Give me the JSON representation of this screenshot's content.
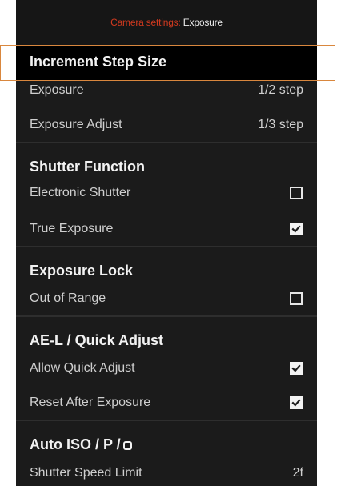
{
  "header": {
    "prefix": "Camera settings:",
    "current": "Exposure"
  },
  "sections": {
    "increment": {
      "title": "Increment Step Size",
      "rows": [
        {
          "label": "Exposure",
          "value": "1/2 step"
        },
        {
          "label": "Exposure Adjust",
          "value": "1/3 step"
        }
      ]
    },
    "shutter": {
      "title": "Shutter Function",
      "rows": [
        {
          "label": "Electronic Shutter",
          "checked": false
        },
        {
          "label": "True Exposure",
          "checked": true
        }
      ]
    },
    "lock": {
      "title": "Exposure Lock",
      "rows": [
        {
          "label": "Out of Range",
          "checked": false
        }
      ]
    },
    "ael": {
      "title": "AE-L / Quick Adjust",
      "rows": [
        {
          "label": "Allow Quick Adjust",
          "checked": true
        },
        {
          "label": "Reset After Exposure",
          "checked": true
        }
      ]
    },
    "autoiso": {
      "title": "Auto ISO / P /",
      "title_icon": "rounded-square-icon",
      "rows": [
        {
          "label": "Shutter Speed Limit",
          "value": "2f"
        }
      ]
    }
  },
  "colors": {
    "accent": "#d33a1f",
    "highlight_outline": "#d9873e",
    "panel_bg": "#1b1b1b"
  }
}
